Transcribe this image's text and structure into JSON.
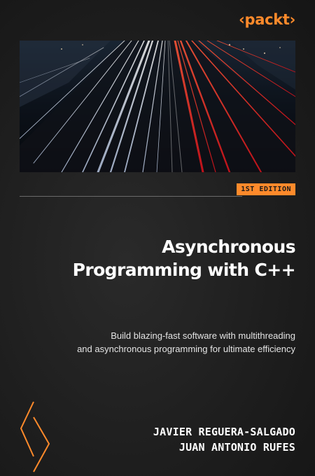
{
  "publisher": {
    "logo_text": "‹packt›"
  },
  "edition": {
    "label": "1ST EDITION"
  },
  "book": {
    "title_lines": [
      "Asynchronous",
      "Programming with C++"
    ],
    "subtitle_lines": [
      "Build blazing-fast software with multithreading",
      "and asynchronous programming for ultimate efficiency"
    ]
  },
  "authors": [
    "JAVIER REGUERA-SALGADO",
    "JUAN ANTONIO RUFES"
  ],
  "colors": {
    "accent": "#ff8a2b",
    "background": "#1c1c1c",
    "text": "#ffffff"
  },
  "icons": {
    "decoration": "chevron-left-icon"
  }
}
